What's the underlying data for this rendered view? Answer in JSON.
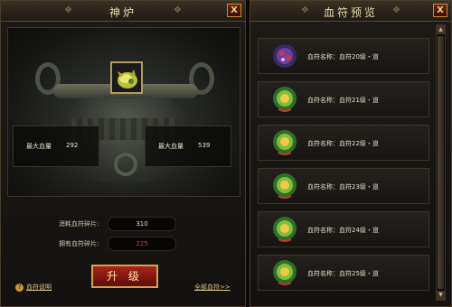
{
  "left_panel": {
    "title": "神炉",
    "close": "X",
    "stats": [
      {
        "label": "最大血量",
        "value": "292"
      },
      {
        "label": "最大血量",
        "value": "539"
      }
    ],
    "cost_label": "消耗血符碎片:",
    "cost_value": "310",
    "owned_label": "拥有血符碎片:",
    "owned_value": "225",
    "owned_color": "#e0302a",
    "upgrade_button": "升 级",
    "help_link": "血符说明",
    "all_link": "全部血符>>"
  },
  "right_panel": {
    "title": "血符预览",
    "close": "X",
    "items": [
      {
        "name": "血符名称：血符20级・道",
        "gem": "purple"
      },
      {
        "name": "血符名称：血符21级・道",
        "gem": "green"
      },
      {
        "name": "血符名称：血符22级・道",
        "gem": "green"
      },
      {
        "name": "血符名称：血符23级・道",
        "gem": "green"
      },
      {
        "name": "血符名称：血符24级・道",
        "gem": "green"
      },
      {
        "name": "血符名称：血符25级・道",
        "gem": "green"
      }
    ]
  },
  "colors": {
    "accent_gold": "#d6a349",
    "button_red": "#a8261b"
  }
}
